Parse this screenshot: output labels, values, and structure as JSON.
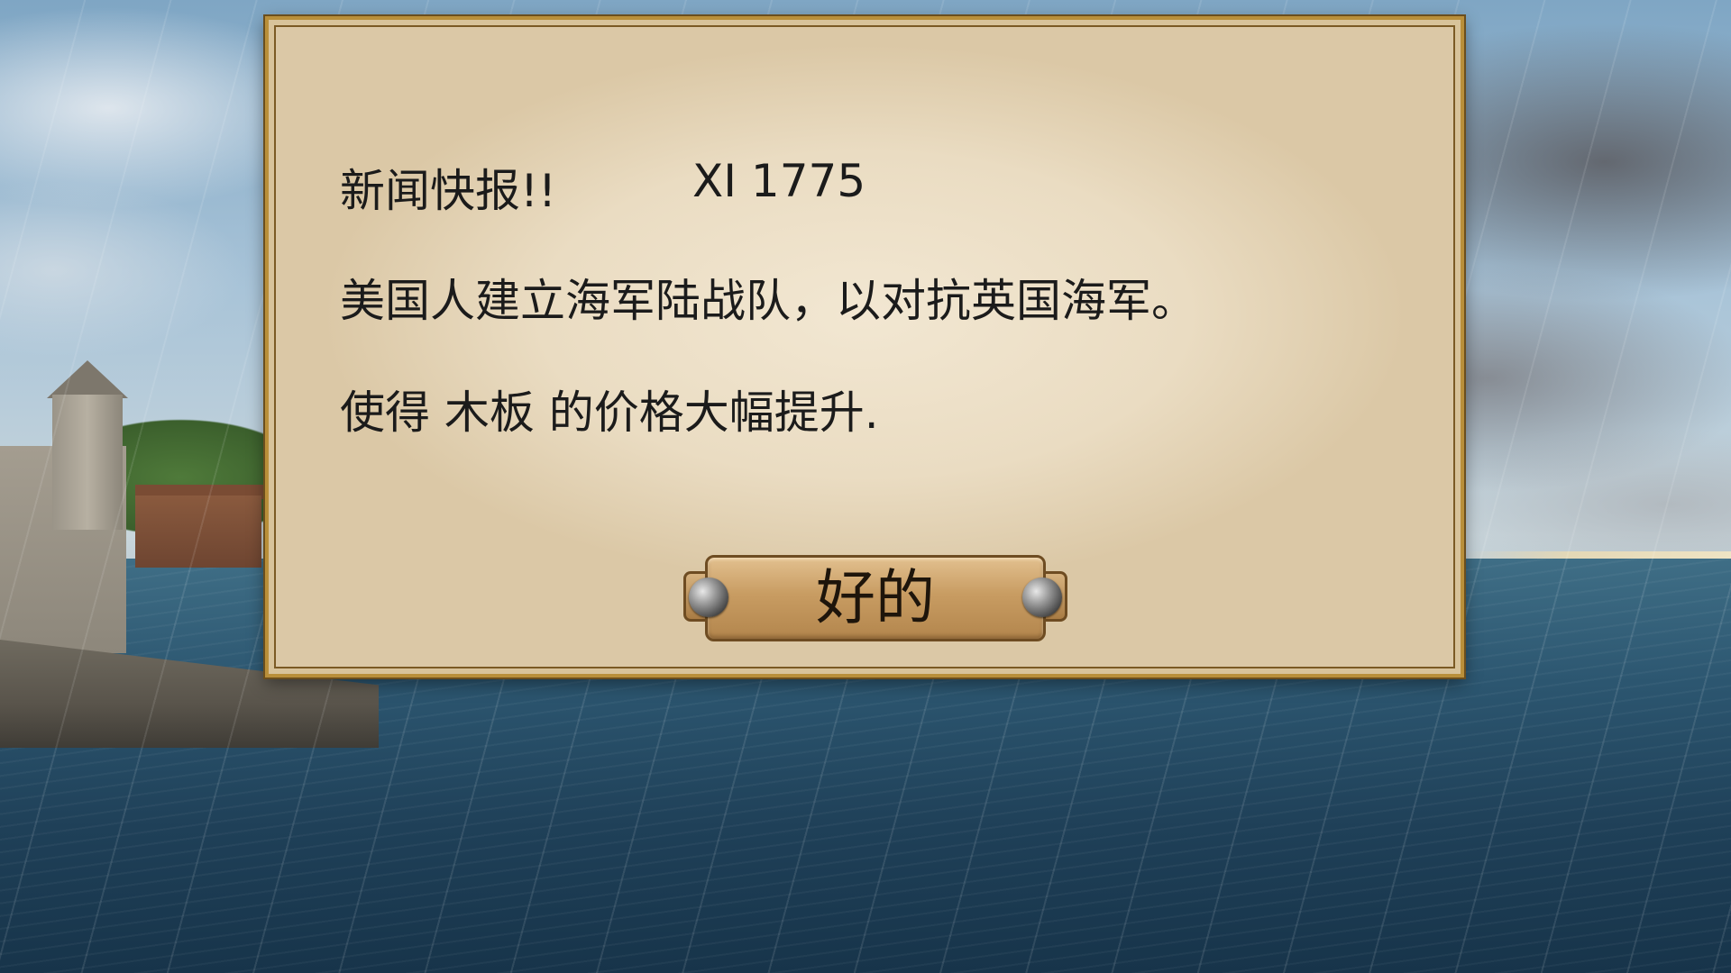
{
  "news_dialog": {
    "header": "新闻快报!!",
    "date": "XI 1775",
    "headline": "美国人建立海军陆战队，以对抗英国海军。",
    "effect": "使得 木板 的价格大幅提升.",
    "ok_label": "好的"
  },
  "colors": {
    "parchment": "#eadcc2",
    "frame_gold": "#b98f3a",
    "button_wood": "#c89c62",
    "text": "#1b1b1b",
    "sea": "#2c5670"
  },
  "icons": {
    "rivet_left": "rivet-icon",
    "rivet_right": "rivet-icon"
  }
}
